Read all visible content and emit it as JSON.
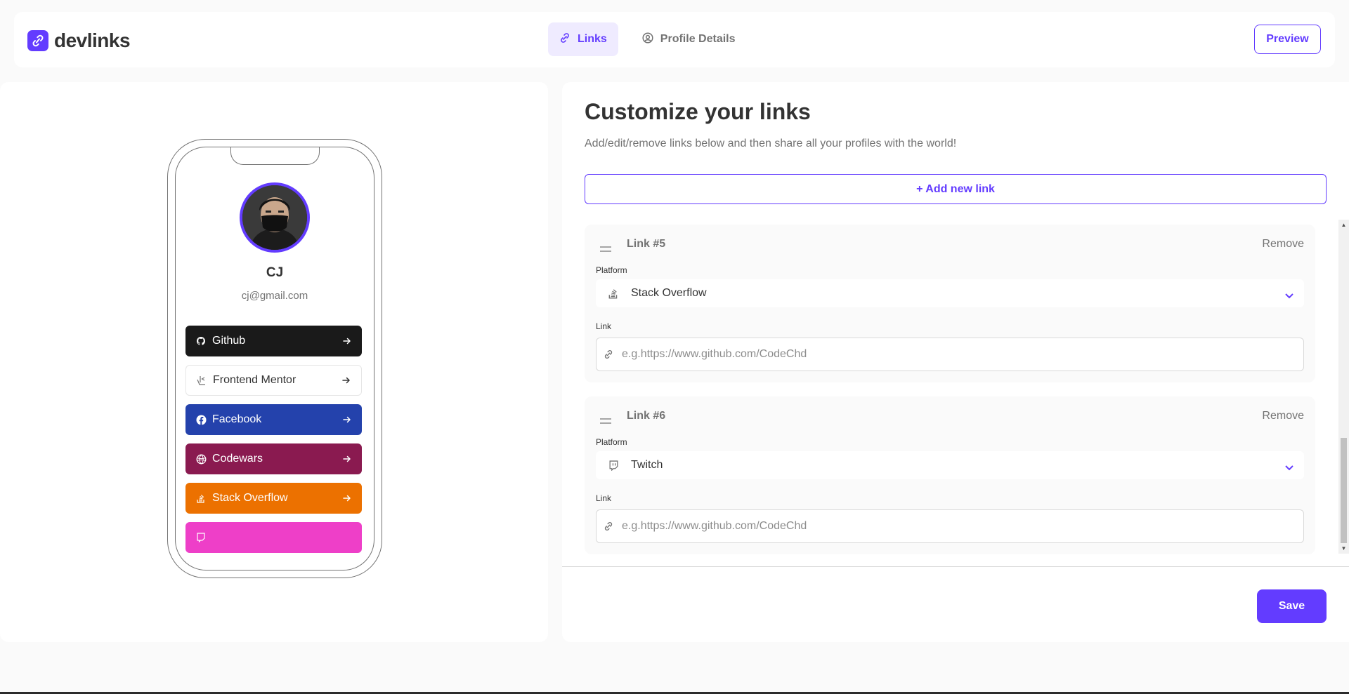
{
  "app": {
    "logo_text": "devlinks",
    "accent_color": "#633cff"
  },
  "nav": {
    "tabs": [
      {
        "label": "Links",
        "icon": "link-icon",
        "active": true
      },
      {
        "label": "Profile Details",
        "icon": "user-circle-icon",
        "active": false
      }
    ],
    "preview_label": "Preview"
  },
  "preview": {
    "name": "CJ",
    "email": "cj@gmail.com",
    "links": [
      {
        "label": "Github",
        "icon": "github-icon",
        "color": "#1a1a1a",
        "text_color": "#ffffff"
      },
      {
        "label": "Frontend Mentor",
        "icon": "frontend-mentor-icon",
        "color": "#ffffff",
        "text_color": "#333333"
      },
      {
        "label": "Facebook",
        "icon": "facebook-icon",
        "color": "#2442ac",
        "text_color": "#ffffff"
      },
      {
        "label": "Codewars",
        "icon": "codewars-icon",
        "color": "#8a1a50",
        "text_color": "#ffffff"
      },
      {
        "label": "Stack Overflow",
        "icon": "stackoverflow-icon",
        "color": "#ec7100",
        "text_color": "#ffffff"
      },
      {
        "label": "",
        "icon": "twitch-icon",
        "color": "#ee3fc8",
        "text_color": "#ffffff"
      }
    ]
  },
  "editor": {
    "title": "Customize your links",
    "subtitle": "Add/edit/remove links below and then share all your profiles with the world!",
    "add_label": "+ Add new link",
    "platform_label": "Platform",
    "link_label": "Link",
    "remove_label": "Remove",
    "links": [
      {
        "title": "Link #5",
        "platform": "Stack Overflow",
        "platform_icon": "stackoverflow-icon",
        "url": "",
        "placeholder": "e.g.https://www.github.com/CodeChd"
      },
      {
        "title": "Link #6",
        "platform": "Twitch",
        "platform_icon": "twitch-icon",
        "url": "",
        "placeholder": "e.g.https://www.github.com/CodeChd"
      }
    ],
    "save_label": "Save"
  }
}
